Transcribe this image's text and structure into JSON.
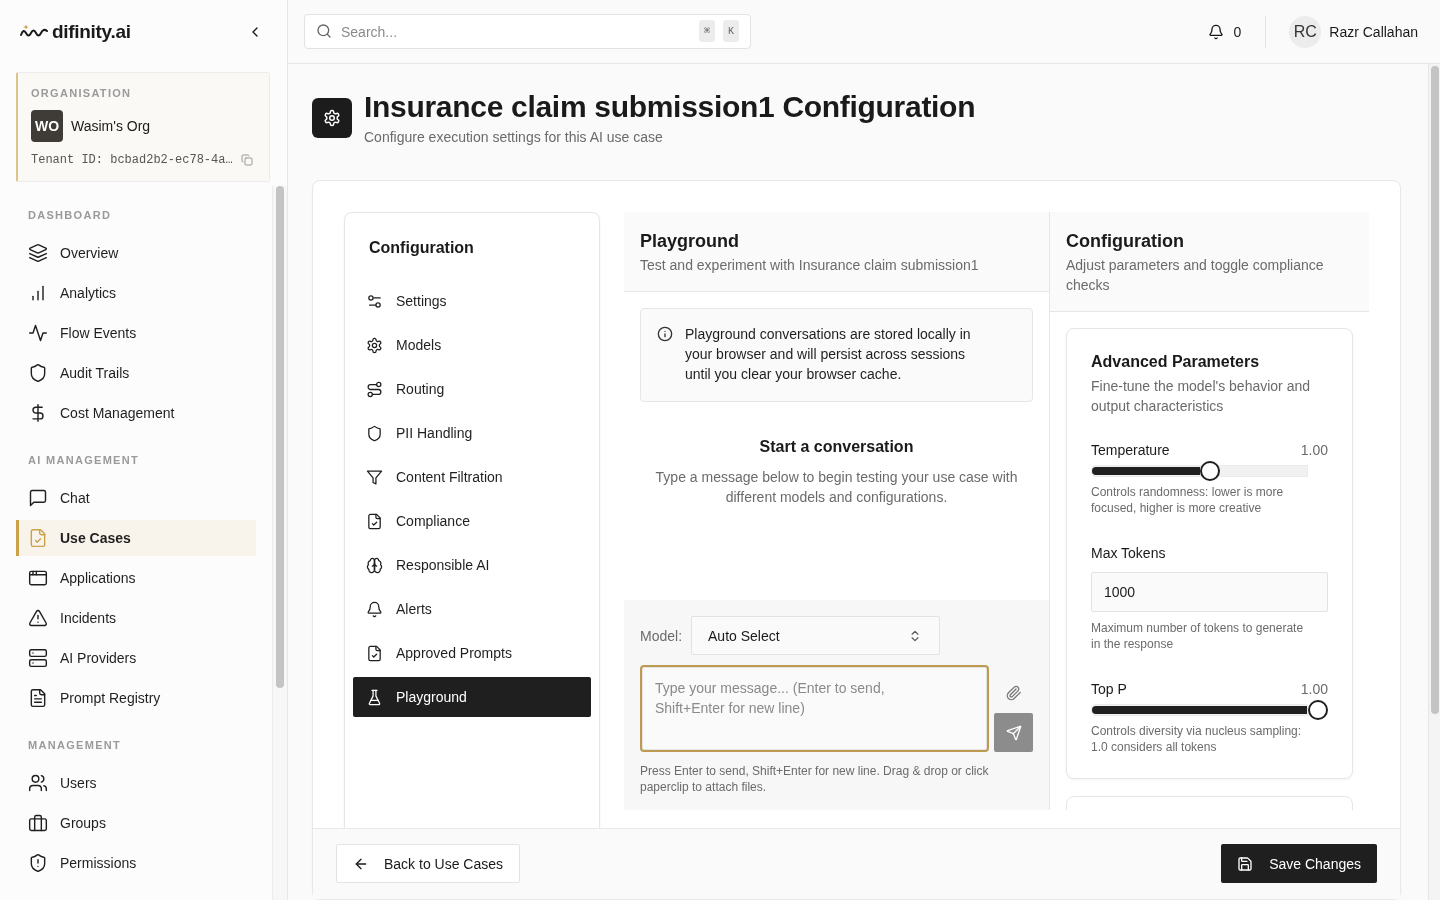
{
  "sidebar": {
    "brand": "difinity.ai",
    "organisation": {
      "label": "ORGANISATION",
      "initials": "WO",
      "name": "Wasim's Org",
      "tenant_id": "Tenant ID: bcbad2b2-ec78-4a…"
    },
    "sections": [
      {
        "title": "DASHBOARD",
        "items": [
          {
            "label": "Overview",
            "selected": false
          },
          {
            "label": "Analytics",
            "selected": false
          },
          {
            "label": "Flow Events",
            "selected": false
          },
          {
            "label": "Audit Trails",
            "selected": false
          },
          {
            "label": "Cost Management",
            "selected": false
          }
        ]
      },
      {
        "title": "AI MANAGEMENT",
        "items": [
          {
            "label": "Chat",
            "selected": false
          },
          {
            "label": "Use Cases",
            "selected": true
          },
          {
            "label": "Applications",
            "selected": false
          },
          {
            "label": "Incidents",
            "selected": false
          },
          {
            "label": "AI Providers",
            "selected": false
          },
          {
            "label": "Prompt Registry",
            "selected": false
          }
        ]
      },
      {
        "title": "MANAGEMENT",
        "items": [
          {
            "label": "Users",
            "selected": false
          },
          {
            "label": "Groups",
            "selected": false
          },
          {
            "label": "Permissions",
            "selected": false
          }
        ]
      }
    ]
  },
  "header": {
    "search": {
      "placeholder": "Search...",
      "shortcut": [
        "⌘",
        "K"
      ]
    },
    "notifications": {
      "count": "0"
    },
    "user": {
      "initials": "RC",
      "name": "Razr Callahan"
    }
  },
  "page": {
    "title": "Insurance claim submission1 Configuration",
    "subtitle": "Configure execution settings for this AI use case"
  },
  "config_nav": {
    "title": "Configuration",
    "items": [
      {
        "label": "Settings",
        "selected": false
      },
      {
        "label": "Models",
        "selected": false
      },
      {
        "label": "Routing",
        "selected": false
      },
      {
        "label": "PII Handling",
        "selected": false
      },
      {
        "label": "Content Filtration",
        "selected": false
      },
      {
        "label": "Compliance",
        "selected": false
      },
      {
        "label": "Responsible AI",
        "selected": false
      },
      {
        "label": "Alerts",
        "selected": false
      },
      {
        "label": "Approved Prompts",
        "selected": false
      },
      {
        "label": "Playground",
        "selected": true
      }
    ]
  },
  "playground": {
    "title": "Playground",
    "subtitle": "Test and experiment with Insurance claim submission1",
    "notice": "Playground conversations are stored locally in your browser and will persist across sessions until you clear your browser cache.",
    "empty_state": {
      "title": "Start a conversation",
      "text": "Type a message below to begin testing your use case with different models and configurations."
    },
    "model": {
      "label": "Model:",
      "value": "Auto Select"
    },
    "message": {
      "placeholder": "Type your message... (Enter to send, Shift+Enter for new line)",
      "focused": true
    },
    "send_button": {
      "disabled": true
    },
    "hint": "Press Enter to send, Shift+Enter for new line. Drag & drop or click paperclip to attach files."
  },
  "config_panel": {
    "title": "Configuration",
    "subtitle": "Adjust parameters and toggle compliance checks",
    "card": {
      "title": "Advanced Parameters",
      "subtitle": "Fine-tune the model's behavior and output characteristics",
      "params": [
        {
          "kind": "slider",
          "label": "Temperature",
          "reading": "1.00",
          "level": 0.5,
          "help": "Controls randomness: lower is more focused, higher is more creative"
        },
        {
          "kind": "number",
          "label": "Max Tokens",
          "value": "1000",
          "help": "Maximum number of tokens to generate in the response"
        },
        {
          "kind": "slider",
          "label": "Top P",
          "reading": "1.00",
          "level": 1,
          "help": "Controls diversity via nucleus sampling: 1.0 considers all tokens"
        }
      ]
    }
  },
  "footer": {
    "back_button": "Back to Use Cases",
    "save_button": "Save Changes"
  }
}
